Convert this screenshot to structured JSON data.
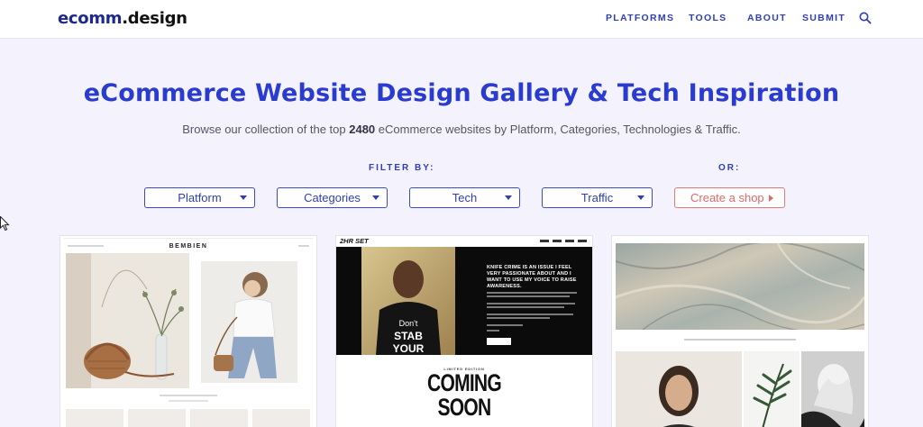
{
  "header": {
    "logo_part1": "ecomm",
    "logo_part2": ".design",
    "nav": [
      "PLATFORMS",
      "TOOLS",
      "ABOUT",
      "SUBMIT"
    ]
  },
  "hero": {
    "title": "eCommerce Website Design Gallery & Tech Inspiration",
    "subtitle_pre": "Browse our collection of the top ",
    "subtitle_count": "2480",
    "subtitle_post": " eCommerce websites by Platform, Categories, Technologies & Traffic."
  },
  "filters": {
    "filter_by_label": "FILTER BY:",
    "or_label": "OR:",
    "dropdowns": [
      "Platform",
      "Categories",
      "Tech",
      "Traffic"
    ],
    "create_shop": "Create a shop"
  },
  "gallery": {
    "card1": {
      "brand": "BEMBIEN"
    },
    "card2": {
      "logo": "2HR SET",
      "quote": "KNIFE CRIME IS AN ISSUE I FEEL VERY PASSIONATE ABOUT AND I WANT TO USE MY VOICE TO RAISE AWARENESS.",
      "shirt_text": "Don't STAB YOUR",
      "tag": "LIMITED EDITION",
      "coming": "COMING",
      "soon": "SOON"
    }
  },
  "colors": {
    "brand_blue": "#2a3ccf",
    "page_bg": "#f3f2fd",
    "accent_red": "#e06a6a"
  }
}
